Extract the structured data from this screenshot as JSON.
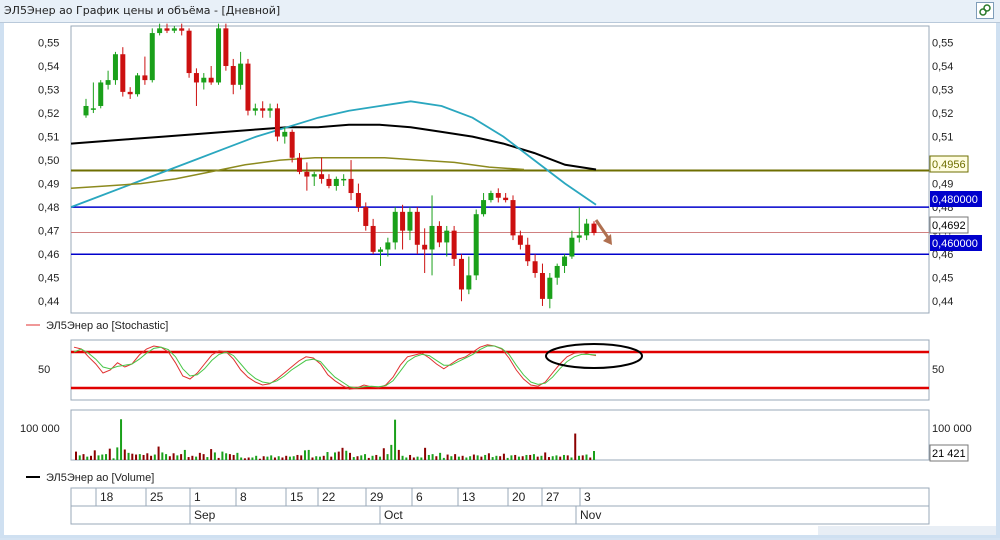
{
  "window": {
    "title": "ЭЛ5Энер ао График цены и объёма - [Дневной]",
    "button_icon": "link-icon"
  },
  "colors": {
    "up": "#1aa01a",
    "down": "#cc1010",
    "ma_black": "#000000",
    "ma_cyan": "#2aa7bf",
    "ma_olive": "#8c8a1e",
    "olive_level": "#6e6e00",
    "blue_level": "#0000cc",
    "red_level": "#d08080",
    "stoch_red": "#e03030",
    "stoch_green": "#49c749",
    "volume_up": "#1aa01a",
    "volume_down": "#8b0000"
  },
  "price_panel": {
    "y_ticks": [
      "0,55",
      "0,54",
      "0,53",
      "0,52",
      "0,51",
      "0,50",
      "0,49",
      "0,48",
      "0,47",
      "0,46",
      "0,45",
      "0,44"
    ],
    "labels": {
      "olive": "0,4956",
      "blue_top": "0,480000",
      "last": "0,4692",
      "blue_bottom": "0,460000"
    }
  },
  "stoch_panel": {
    "legend": "ЭЛ5Энер ао [Stochastic]",
    "y_tick": "50"
  },
  "volume_panel": {
    "y_tick": "100 000",
    "last": "21 421",
    "legend": "ЭЛ5Энер ао [Volume]"
  },
  "date_axis": {
    "days": [
      "18",
      "25",
      "1",
      "8",
      "15",
      "22",
      "29",
      "6",
      "13",
      "20",
      "27",
      "3"
    ],
    "months": [
      "Sep",
      "Oct",
      "Nov"
    ]
  },
  "chart_data": [
    {
      "type": "candlestick",
      "ylim": [
        0.435,
        0.557
      ],
      "candles": [
        {
          "o": 0.519,
          "h": 0.526,
          "l": 0.518,
          "c": 0.523
        },
        {
          "o": 0.522,
          "h": 0.533,
          "l": 0.52,
          "c": 0.522
        },
        {
          "o": 0.523,
          "h": 0.534,
          "l": 0.522,
          "c": 0.533
        },
        {
          "o": 0.532,
          "h": 0.538,
          "l": 0.53,
          "c": 0.534
        },
        {
          "o": 0.534,
          "h": 0.546,
          "l": 0.532,
          "c": 0.545
        },
        {
          "o": 0.545,
          "h": 0.548,
          "l": 0.527,
          "c": 0.529
        },
        {
          "o": 0.529,
          "h": 0.531,
          "l": 0.526,
          "c": 0.528
        },
        {
          "o": 0.528,
          "h": 0.537,
          "l": 0.527,
          "c": 0.536
        },
        {
          "o": 0.536,
          "h": 0.544,
          "l": 0.532,
          "c": 0.534
        },
        {
          "o": 0.534,
          "h": 0.556,
          "l": 0.533,
          "c": 0.554
        },
        {
          "o": 0.554,
          "h": 0.558,
          "l": 0.553,
          "c": 0.556
        },
        {
          "o": 0.556,
          "h": 0.558,
          "l": 0.554,
          "c": 0.555
        },
        {
          "o": 0.555,
          "h": 0.557,
          "l": 0.554,
          "c": 0.556
        },
        {
          "o": 0.556,
          "h": 0.558,
          "l": 0.553,
          "c": 0.555
        },
        {
          "o": 0.555,
          "h": 0.556,
          "l": 0.535,
          "c": 0.537
        },
        {
          "o": 0.537,
          "h": 0.539,
          "l": 0.523,
          "c": 0.533
        },
        {
          "o": 0.533,
          "h": 0.537,
          "l": 0.53,
          "c": 0.535
        },
        {
          "o": 0.535,
          "h": 0.54,
          "l": 0.532,
          "c": 0.533
        },
        {
          "o": 0.533,
          "h": 0.558,
          "l": 0.532,
          "c": 0.556
        },
        {
          "o": 0.556,
          "h": 0.558,
          "l": 0.538,
          "c": 0.54
        },
        {
          "o": 0.54,
          "h": 0.543,
          "l": 0.528,
          "c": 0.532
        },
        {
          "o": 0.532,
          "h": 0.546,
          "l": 0.53,
          "c": 0.541
        },
        {
          "o": 0.541,
          "h": 0.543,
          "l": 0.519,
          "c": 0.521
        },
        {
          "o": 0.521,
          "h": 0.524,
          "l": 0.519,
          "c": 0.522
        },
        {
          "o": 0.522,
          "h": 0.525,
          "l": 0.518,
          "c": 0.521
        },
        {
          "o": 0.521,
          "h": 0.524,
          "l": 0.518,
          "c": 0.522
        },
        {
          "o": 0.522,
          "h": 0.524,
          "l": 0.508,
          "c": 0.51
        },
        {
          "o": 0.51,
          "h": 0.514,
          "l": 0.507,
          "c": 0.512
        },
        {
          "o": 0.512,
          "h": 0.513,
          "l": 0.499,
          "c": 0.501
        },
        {
          "o": 0.501,
          "h": 0.503,
          "l": 0.494,
          "c": 0.495
        },
        {
          "o": 0.495,
          "h": 0.499,
          "l": 0.487,
          "c": 0.493
        },
        {
          "o": 0.493,
          "h": 0.495,
          "l": 0.489,
          "c": 0.494
        },
        {
          "o": 0.494,
          "h": 0.501,
          "l": 0.49,
          "c": 0.492
        },
        {
          "o": 0.492,
          "h": 0.494,
          "l": 0.488,
          "c": 0.489
        },
        {
          "o": 0.489,
          "h": 0.493,
          "l": 0.487,
          "c": 0.492
        },
        {
          "o": 0.492,
          "h": 0.494,
          "l": 0.489,
          "c": 0.492
        },
        {
          "o": 0.492,
          "h": 0.5,
          "l": 0.483,
          "c": 0.486
        },
        {
          "o": 0.486,
          "h": 0.49,
          "l": 0.478,
          "c": 0.48
        },
        {
          "o": 0.48,
          "h": 0.482,
          "l": 0.47,
          "c": 0.472
        },
        {
          "o": 0.472,
          "h": 0.475,
          "l": 0.46,
          "c": 0.461
        },
        {
          "o": 0.461,
          "h": 0.463,
          "l": 0.455,
          "c": 0.462
        },
        {
          "o": 0.462,
          "h": 0.467,
          "l": 0.459,
          "c": 0.465
        },
        {
          "o": 0.465,
          "h": 0.48,
          "l": 0.462,
          "c": 0.478
        },
        {
          "o": 0.478,
          "h": 0.481,
          "l": 0.462,
          "c": 0.47
        },
        {
          "o": 0.47,
          "h": 0.48,
          "l": 0.466,
          "c": 0.478
        },
        {
          "o": 0.478,
          "h": 0.48,
          "l": 0.46,
          "c": 0.464
        },
        {
          "o": 0.464,
          "h": 0.471,
          "l": 0.452,
          "c": 0.462
        },
        {
          "o": 0.462,
          "h": 0.485,
          "l": 0.451,
          "c": 0.472
        },
        {
          "o": 0.472,
          "h": 0.474,
          "l": 0.463,
          "c": 0.465
        },
        {
          "o": 0.465,
          "h": 0.472,
          "l": 0.459,
          "c": 0.47
        },
        {
          "o": 0.47,
          "h": 0.472,
          "l": 0.455,
          "c": 0.458
        },
        {
          "o": 0.458,
          "h": 0.46,
          "l": 0.44,
          "c": 0.445
        },
        {
          "o": 0.445,
          "h": 0.459,
          "l": 0.443,
          "c": 0.451
        },
        {
          "o": 0.451,
          "h": 0.479,
          "l": 0.449,
          "c": 0.477
        },
        {
          "o": 0.477,
          "h": 0.486,
          "l": 0.476,
          "c": 0.483
        },
        {
          "o": 0.483,
          "h": 0.487,
          "l": 0.482,
          "c": 0.486
        },
        {
          "o": 0.486,
          "h": 0.488,
          "l": 0.482,
          "c": 0.484
        },
        {
          "o": 0.484,
          "h": 0.486,
          "l": 0.482,
          "c": 0.483
        },
        {
          "o": 0.483,
          "h": 0.485,
          "l": 0.466,
          "c": 0.468
        },
        {
          "o": 0.468,
          "h": 0.47,
          "l": 0.462,
          "c": 0.464
        },
        {
          "o": 0.464,
          "h": 0.467,
          "l": 0.455,
          "c": 0.457
        },
        {
          "o": 0.457,
          "h": 0.46,
          "l": 0.45,
          "c": 0.452
        },
        {
          "o": 0.452,
          "h": 0.456,
          "l": 0.438,
          "c": 0.441
        },
        {
          "o": 0.441,
          "h": 0.452,
          "l": 0.437,
          "c": 0.45
        },
        {
          "o": 0.45,
          "h": 0.456,
          "l": 0.447,
          "c": 0.455
        },
        {
          "o": 0.455,
          "h": 0.46,
          "l": 0.452,
          "c": 0.459
        },
        {
          "o": 0.459,
          "h": 0.47,
          "l": 0.458,
          "c": 0.467
        },
        {
          "o": 0.467,
          "h": 0.48,
          "l": 0.465,
          "c": 0.468
        },
        {
          "o": 0.468,
          "h": 0.475,
          "l": 0.466,
          "c": 0.473
        },
        {
          "o": 0.473,
          "h": 0.474,
          "l": 0.468,
          "c": 0.469
        }
      ],
      "levels": [
        0.4956,
        0.48,
        0.4692,
        0.46
      ],
      "series": [
        {
          "values": [
            0.507,
            0.508,
            0.509,
            0.51,
            0.511,
            0.512,
            0.513,
            0.514,
            0.514,
            0.515,
            0.515,
            0.514,
            0.512,
            0.51,
            0.507,
            0.503,
            0.498,
            0.496
          ]
        },
        {
          "values": [
            0.48,
            0.485,
            0.49,
            0.495,
            0.5,
            0.505,
            0.51,
            0.514,
            0.518,
            0.521,
            0.523,
            0.525,
            0.523,
            0.518,
            0.51,
            0.5,
            0.49,
            0.481
          ]
        },
        {
          "values": [
            0.488,
            0.489,
            0.49,
            0.492,
            0.495,
            0.498,
            0.5,
            0.501,
            0.501,
            0.501,
            0.5,
            0.499,
            0.497,
            0.496
          ]
        }
      ]
    },
    {
      "type": "line",
      "ylim": [
        0,
        100
      ],
      "levels": [
        80,
        20
      ],
      "series": [
        {
          "values": [
            88,
            85,
            72,
            60,
            45,
            50,
            62,
            55,
            60,
            75,
            85,
            90,
            88,
            80,
            62,
            40,
            35,
            45,
            60,
            75,
            82,
            80,
            68,
            50,
            38,
            30,
            25,
            27,
            35,
            45,
            55,
            65,
            72,
            70,
            60,
            42,
            32,
            24,
            18,
            20,
            25,
            22,
            20,
            25,
            38,
            58,
            72,
            75,
            78,
            70,
            60,
            52,
            60,
            68,
            72,
            80,
            88,
            92,
            90,
            85,
            70,
            50,
            35,
            25,
            23,
            30,
            45,
            60,
            72,
            78,
            80,
            76,
            74
          ]
        },
        {
          "values": [
            80,
            85,
            78,
            68,
            55,
            52,
            56,
            58,
            60,
            68,
            78,
            86,
            88,
            84,
            72,
            52,
            40,
            42,
            52,
            66,
            76,
            80,
            74,
            60,
            46,
            36,
            30,
            28,
            32,
            40,
            50,
            58,
            66,
            68,
            64,
            50,
            38,
            30,
            22,
            20,
            22,
            23,
            22,
            24,
            32,
            48,
            64,
            72,
            76,
            74,
            66,
            58,
            58,
            64,
            70,
            76,
            84,
            90,
            90,
            86,
            76,
            58,
            42,
            30,
            26,
            28,
            38,
            52,
            64,
            72,
            76,
            76,
            75
          ]
        }
      ]
    },
    {
      "type": "bar",
      "ylim": [
        0,
        100000
      ],
      "last_value": 21421,
      "values": [
        20000,
        11000,
        14000,
        8000,
        10000,
        23000,
        11000,
        13000,
        14000,
        27000,
        4000,
        30000,
        97000,
        25000,
        17000,
        15000,
        13000,
        14000,
        12000,
        16000,
        10000,
        13000,
        32000,
        18000,
        14000,
        9000,
        16000,
        11000,
        14000,
        24000,
        7000,
        10000,
        8000,
        17000,
        14000,
        7000,
        26000,
        18000,
        5000,
        20000,
        16000,
        14000,
        12000,
        17000,
        6000,
        4000,
        6000,
        6000,
        10000,
        3000,
        9000,
        8000,
        11000,
        6000,
        9000,
        6000,
        10000,
        8000,
        9000,
        12000,
        11000,
        23000,
        24000,
        6000,
        9000,
        8000,
        10000,
        19000,
        8000,
        18000,
        20000,
        29000,
        22000,
        17000,
        7000,
        9000,
        11000,
        14000,
        5000,
        10000,
        12000,
        8000,
        28000,
        14000,
        36000,
        96000,
        24000,
        10000,
        6000,
        12000,
        6000,
        8000,
        6000,
        29000,
        12000,
        14000,
        9000,
        17000,
        5000,
        13000,
        9000,
        14000,
        8000,
        10000,
        6000,
        9000,
        13000,
        11000,
        8000,
        12000,
        16000,
        7000,
        10000,
        9000,
        15000,
        5000,
        11000,
        12000,
        8000,
        9000,
        12000,
        12000,
        14000,
        8000,
        10000,
        18000,
        7000,
        9000,
        11000,
        8000,
        12000,
        11000,
        6000,
        63000,
        10000,
        11000,
        13000,
        6000,
        21421
      ],
      "down_indices": [
        0,
        2,
        4,
        5,
        9,
        13,
        15,
        16,
        18,
        19,
        20,
        22,
        25,
        26,
        28,
        30,
        31,
        33,
        34,
        36,
        38,
        41,
        42,
        45,
        46,
        49,
        50,
        53,
        55,
        56,
        59,
        60,
        63,
        66,
        68,
        70,
        71,
        73,
        75,
        78,
        80,
        82,
        86,
        89,
        90,
        93,
        96,
        99,
        101,
        103,
        106,
        108,
        110,
        113,
        114,
        117,
        119,
        121,
        123,
        125,
        126,
        129,
        131,
        133,
        135,
        137
      ]
    }
  ]
}
